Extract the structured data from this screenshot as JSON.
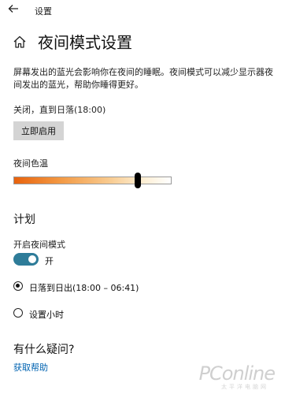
{
  "titlebar": {
    "title": "设置",
    "back_icon": "back-arrow-icon"
  },
  "header": {
    "home_icon": "home-icon",
    "title": "夜间模式设置"
  },
  "description": "屏幕发出的蓝光会影响你在夜间的睡眠。夜间模式可以减少显示器夜间发出的蓝光，帮助你睡得更好。",
  "status_text": "关闭，直到日落(18:00)",
  "enable_button_label": "立即启用",
  "color_temp": {
    "label": "夜间色温",
    "value_fraction": 0.79,
    "gradient_colors": [
      "#e8620d",
      "#f39a45",
      "#f8c98d",
      "#fdeed2",
      "#ffffff"
    ]
  },
  "schedule": {
    "title": "计划",
    "toggle_label": "开启夜间模式",
    "toggle_on": true,
    "toggle_state_text": "开",
    "options": [
      {
        "label": "日落到日出(18:00 – 06:41)",
        "selected": true
      },
      {
        "label": "设置小时",
        "selected": false
      }
    ]
  },
  "faq": {
    "title": "有什么疑问?",
    "help_link": "获取帮助"
  },
  "watermark": {
    "text": "PConline",
    "subtext": "太平洋电脑网"
  },
  "colors": {
    "accent": "#2e7c99",
    "link": "#0063b1",
    "button_bg": "#d4d4d4"
  }
}
